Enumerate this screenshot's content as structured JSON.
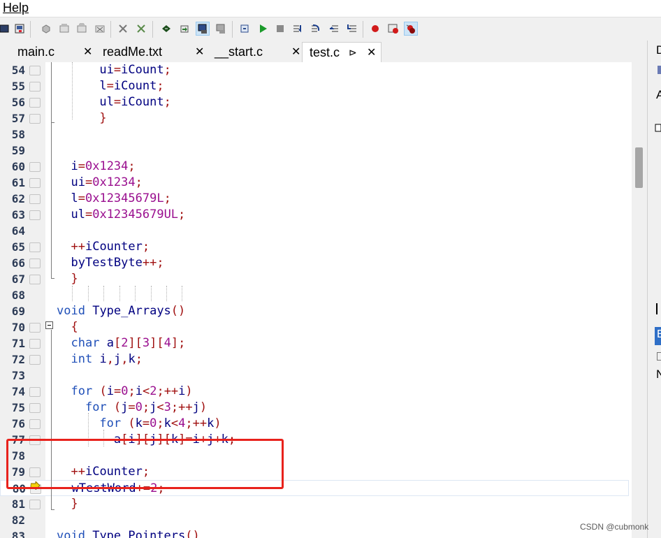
{
  "menubar": {
    "help": "Help"
  },
  "toolbar": {
    "icons": [
      "window-icon",
      "save-icon",
      "build-icon",
      "compile-icon",
      "rebuild-icon",
      "clean-icon",
      "flash-icon",
      "erase-icon",
      "load-icon",
      "download-icon",
      "debug-icon",
      "options-icon",
      "reset-icon",
      "run-icon",
      "stop-icon",
      "step-into-icon",
      "step-over-icon",
      "step-out-icon",
      "run-to-cursor-icon",
      "breakpoint-icon",
      "disable-breakpoint-icon",
      "kill-breakpoints-icon"
    ]
  },
  "tabs": [
    {
      "label": "main.c",
      "close": "✕"
    },
    {
      "label": "readMe.txt",
      "close": "✕"
    },
    {
      "label": "__start.c",
      "close": "✕"
    },
    {
      "label": "test.c",
      "close": "✕",
      "pin": "⊳"
    }
  ],
  "right_panel": {
    "letters": [
      "D",
      "A",
      "E",
      "N"
    ]
  },
  "watermark": "CSDN @cubmonk",
  "code_lines": [
    {
      "n": "54",
      "bp": true
    },
    {
      "n": "55",
      "bp": true
    },
    {
      "n": "56",
      "bp": true
    },
    {
      "n": "57",
      "bp": true
    },
    {
      "n": "58",
      "bp": false
    },
    {
      "n": "59",
      "bp": false
    },
    {
      "n": "60",
      "bp": true
    },
    {
      "n": "61",
      "bp": true
    },
    {
      "n": "62",
      "bp": true
    },
    {
      "n": "63",
      "bp": true
    },
    {
      "n": "64",
      "bp": false
    },
    {
      "n": "65",
      "bp": true
    },
    {
      "n": "66",
      "bp": true
    },
    {
      "n": "67",
      "bp": true
    },
    {
      "n": "68",
      "bp": false
    },
    {
      "n": "69",
      "bp": false
    },
    {
      "n": "70",
      "bp": true
    },
    {
      "n": "71",
      "bp": true
    },
    {
      "n": "72",
      "bp": true
    },
    {
      "n": "73",
      "bp": false
    },
    {
      "n": "74",
      "bp": true
    },
    {
      "n": "75",
      "bp": true
    },
    {
      "n": "76",
      "bp": true
    },
    {
      "n": "77",
      "bp": true
    },
    {
      "n": "78",
      "bp": false
    },
    {
      "n": "79",
      "bp": true
    },
    {
      "n": "80",
      "bp": true
    },
    {
      "n": "81",
      "bp": true
    },
    {
      "n": "82",
      "bp": false
    },
    {
      "n": "83",
      "bp": false
    }
  ]
}
